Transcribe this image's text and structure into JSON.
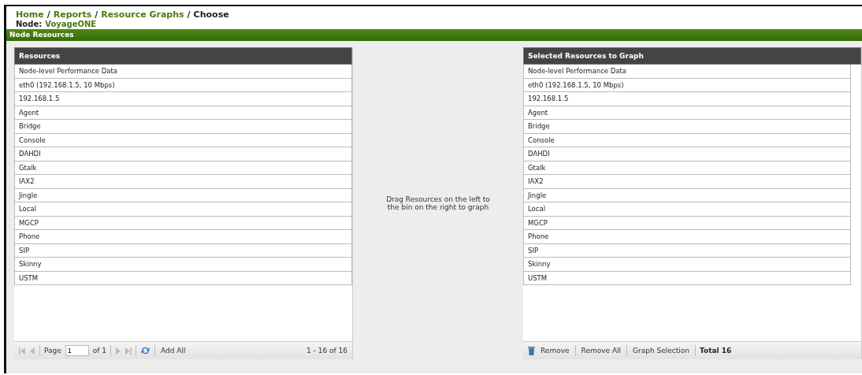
{
  "breadcrumb": [
    {
      "label": "Home",
      "kind": "link"
    },
    {
      "label": "Reports",
      "kind": "link"
    },
    {
      "label": "Resource Graphs",
      "kind": "link"
    },
    {
      "label": "Choose",
      "kind": "current"
    }
  ],
  "breadcrumb_separator": "/",
  "node": {
    "label": "Node:",
    "value": "VoyageONE"
  },
  "section_title": "Node Resources",
  "resources": {
    "header": "Resources",
    "rows": [
      "Node-level Performance Data",
      "eth0 (192.168.1.5, 10 Mbps)",
      "192.168.1.5",
      "Agent",
      "Bridge",
      "Console",
      "DAHDI",
      "Gtalk",
      "IAX2",
      "Jingle",
      "Local",
      "MGCP",
      "Phone",
      "SIP",
      "Skinny",
      "USTM"
    ],
    "pager": {
      "page_label": "Page",
      "page": "1",
      "of": "of 1",
      "add_all": "Add All",
      "range": "1 - 16 of 16"
    }
  },
  "hint": "Drag Resources on the left to the bin on the right to graph",
  "selected": {
    "header": "Selected Resources to Graph",
    "rows": [
      "Node-level Performance Data",
      "eth0 (192.168.1.5, 10 Mbps)",
      "192.168.1.5",
      "Agent",
      "Bridge",
      "Console",
      "DAHDI",
      "Gtalk",
      "IAX2",
      "Jingle",
      "Local",
      "MGCP",
      "Phone",
      "SIP",
      "Skinny",
      "USTM"
    ],
    "toolbar": {
      "remove": "Remove",
      "remove_all": "Remove All",
      "graph_selection": "Graph Selection",
      "total": "Total 16"
    }
  }
}
